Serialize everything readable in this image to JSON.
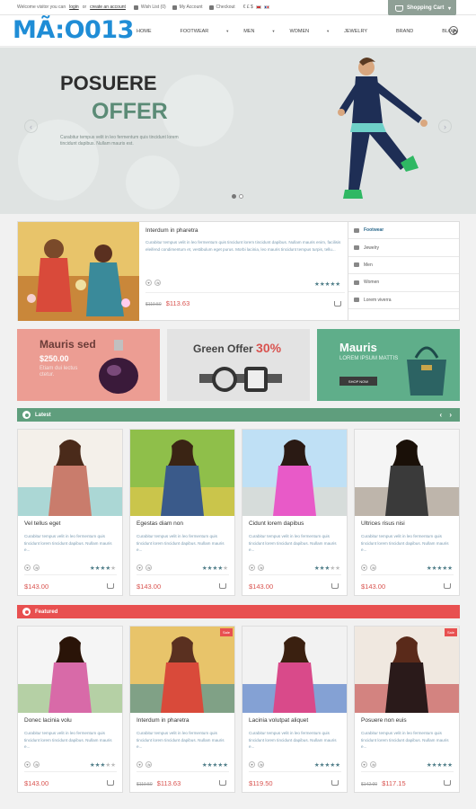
{
  "topbar": {
    "welcome": "Welcome visitor you can",
    "login": "login",
    "or": "or",
    "create_account": "create an account",
    "wishlist": "Wish List (0)",
    "my_account": "My Account",
    "checkout": "Checkout",
    "currencies": "€  £  $",
    "cart_label": "Shopping Cart"
  },
  "header": {
    "logo": "MÃ:O013",
    "nav": [
      "HOME",
      "FOOTWEAR",
      "MEN",
      "WOMEN",
      "JEWELRY",
      "BRAND",
      "BLOG"
    ]
  },
  "hero": {
    "title": "POSUERE",
    "subtitle": "OFFER",
    "text": "Curabitur tempus velit in leo fermentum quis tincidunt lorem tincidunt dapibus. Nullam mauris est."
  },
  "featured_product": {
    "title": "Interdum in pharetra",
    "desc": "Curabitur tempus velit in leo fermentum quis tincidunt lorem tincidunt dapibus. Nullam mauris enim, facilisis eleifend condimentum et, vestibulum eget purus. Morbi lacinia, leo mauris tincidunt tempus turpis, tellu...",
    "old_price": "$119.50",
    "price": "$113.63",
    "rating": 5,
    "categories": [
      "Footwear",
      "Jewelry",
      "Men",
      "Women",
      "Lorem viverra"
    ]
  },
  "banners": {
    "b1_title": "Mauris sed",
    "b1_price": "$250.00",
    "b1_sub": "Etiam dui lectus ctetur.",
    "b2_title": "Green Offer ",
    "b2_pct": "30%",
    "b3_title": "Mauris",
    "b3_sub": "LOREM IPSUM MATTIS",
    "b3_btn": "SHOP NOW"
  },
  "sections": {
    "latest": "Latest",
    "featured": "Featured",
    "arrows": "‹ ›"
  },
  "latest_products": [
    {
      "name": "Vel tellus eget",
      "desc": "Curabitur tempus velit in leo fermentum quis tincidunt lorem tincidunt dapibus. Nullam mauris e...",
      "price": "$143.00",
      "old_price": "",
      "rating": 4
    },
    {
      "name": "Egestas diam non",
      "desc": "Curabitur tempus velit in leo fermentum quis tincidunt lorem tincidunt dapibus. Nullam mauris e...",
      "price": "$143.00",
      "old_price": "",
      "rating": 4
    },
    {
      "name": "Cidunt lorem dapibus",
      "desc": "Curabitur tempus velit in leo fermentum quis tincidunt lorem tincidunt dapibus. Nullam mauris e...",
      "price": "$143.00",
      "old_price": "",
      "rating": 3
    },
    {
      "name": "Ultrices risus nisi",
      "desc": "Curabitur tempus velit in leo fermentum quis tincidunt lorem tincidunt dapibus. Nullam mauris e...",
      "price": "$143.00",
      "old_price": "",
      "rating": 5
    }
  ],
  "featured_products": [
    {
      "name": "Donec lacinia volu",
      "desc": "Curabitur tempus velit in leo fermentum quis tincidunt lorem tincidunt dapibus. Nullam mauris e...",
      "price": "$143.00",
      "old_price": "",
      "rating": 3,
      "sale": ""
    },
    {
      "name": "Interdum in pharetra",
      "desc": "Curabitur tempus velit in leo fermentum quis tincidunt lorem tincidunt dapibus. Nullam mauris e...",
      "price": "$113.63",
      "old_price": "$119.50",
      "rating": 5,
      "sale": "Sale"
    },
    {
      "name": "Lacinia volutpat aliquet",
      "desc": "Curabitur tempus velit in leo fermentum quis tincidunt lorem tincidunt dapibus. Nullam mauris e...",
      "price": "$119.50",
      "old_price": "",
      "rating": 5,
      "sale": ""
    },
    {
      "name": "Posuere non euis",
      "desc": "Curabitur tempus velit in leo fermentum quis tincidunt lorem tincidunt dapibus. Nullam mauris e...",
      "price": "$117.15",
      "old_price": "$142.00",
      "rating": 5,
      "sale": "Sale"
    }
  ],
  "colors": {
    "accent_green": "#5f9e7d",
    "accent_red": "#e85050",
    "price_red": "#d9534f",
    "logo_blue": "#1f8dd6"
  }
}
